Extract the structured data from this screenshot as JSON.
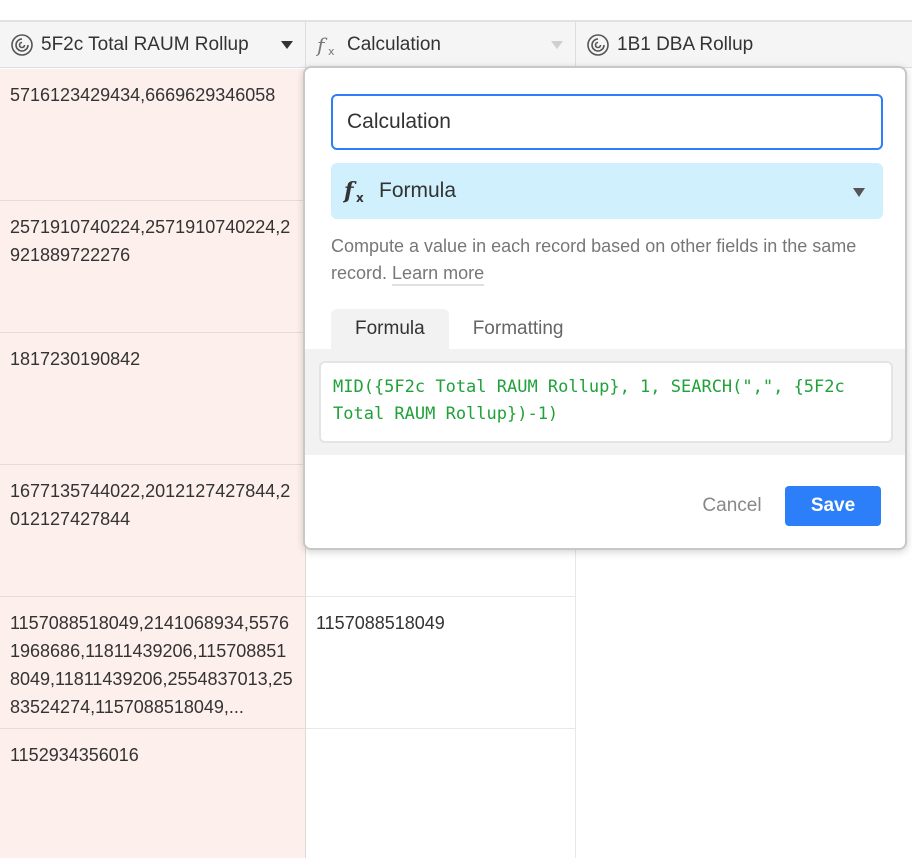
{
  "grid": {
    "columns": [
      {
        "name": "5F2c Total RAUM Rollup",
        "icon": "rollup-icon"
      },
      {
        "name": "Calculation",
        "icon": "formula-icon"
      },
      {
        "name": "1B1 DBA Rollup",
        "icon": "rollup-icon"
      }
    ],
    "rows": [
      {
        "a": "5716123429434,6669629346058",
        "b": ""
      },
      {
        "a": "2571910740224,2571910740224,2921889722276",
        "b": ""
      },
      {
        "a": "1817230190842",
        "b": ""
      },
      {
        "a": "1677135744022,2012127427844,2012127427844",
        "b": ""
      },
      {
        "a": "1157088518049,2141068934,55761968686,11811439206,1157088518049,11811439206,2554837013,2583524274,1157088518049,...",
        "b": "1157088518049"
      },
      {
        "a": "1152934356016",
        "b": ""
      }
    ]
  },
  "popup": {
    "field_name": "Calculation",
    "field_type": "Formula",
    "description": "Compute a value in each record based on other fields in the same record.",
    "learn_more": "Learn more",
    "tabs": [
      "Formula",
      "Formatting"
    ],
    "formula": "MID({5F2c Total RAUM Rollup}, 1, SEARCH(\",\", {5F2c Total RAUM Rollup})-1)",
    "cancel_label": "Cancel",
    "save_label": "Save"
  },
  "colors": {
    "accent": "#2d7ff9",
    "formula_text": "#20a13a",
    "type_select_bg": "#d0f0fd",
    "primary_column_bg": "#fdf0ec"
  }
}
